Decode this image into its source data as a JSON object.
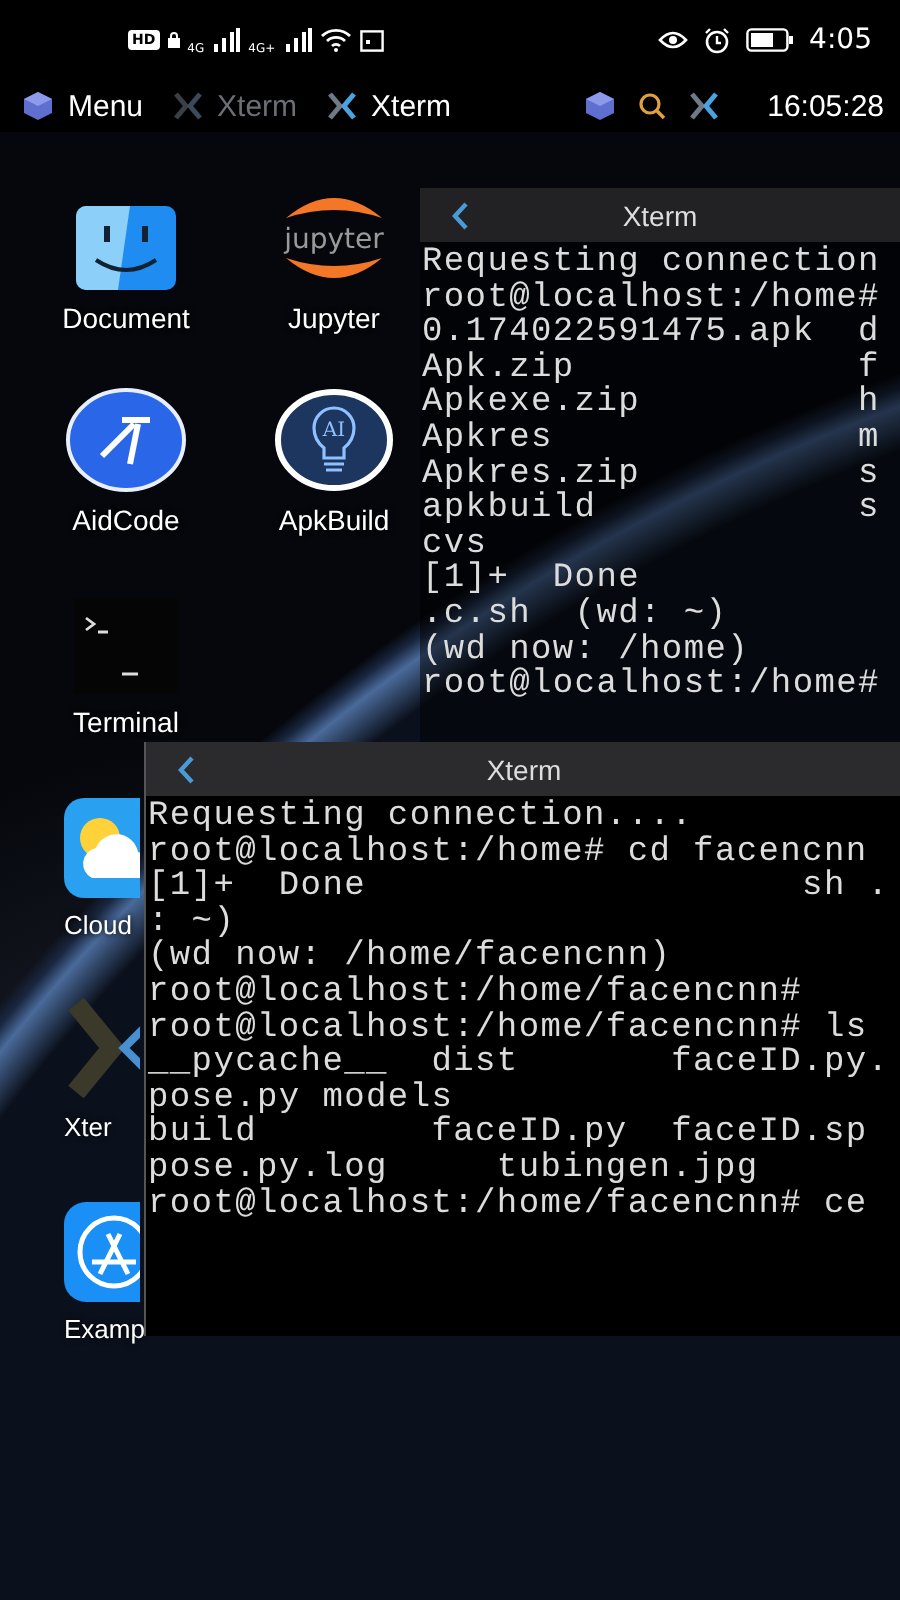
{
  "status_bar": {
    "badges": [
      "HD",
      "4G",
      "4G+"
    ],
    "time": "4:05"
  },
  "taskbar": {
    "items": [
      {
        "kind": "menu",
        "label": "Menu"
      },
      {
        "kind": "window",
        "label": "Xterm",
        "selected": false
      },
      {
        "kind": "window",
        "label": "Xterm",
        "selected": true
      }
    ],
    "clock": "16:05:28"
  },
  "desktop_icons": [
    {
      "kind": "finder",
      "label": "Document"
    },
    {
      "kind": "jupyter",
      "label": "Jupyter",
      "logo_text": "jupyter"
    },
    {
      "kind": "aidcode",
      "label": "AidCode"
    },
    {
      "kind": "bulb",
      "label": "ApkBuild",
      "logo_text": "AI"
    },
    {
      "kind": "terminal",
      "label": "Terminal"
    },
    {
      "kind": "weather",
      "label": "Cloud"
    },
    {
      "kind": "xterm",
      "label": "Xter"
    },
    {
      "kind": "appstore",
      "label": "Examp"
    }
  ],
  "windows": [
    {
      "title": "Xterm",
      "translucent": true,
      "lines": [
        "Requesting connection",
        "root@localhost:/home#",
        "0.174022591475.apk  d",
        "Apk.zip             f",
        "Apkexe.zip          h",
        "Apkres              m",
        "Apkres.zip          s",
        "apkbuild            s",
        "cvs",
        "[1]+  Done",
        ".c.sh  (wd: ~)",
        "(wd now: /home)",
        "root@localhost:/home#"
      ]
    },
    {
      "title": "Xterm",
      "translucent": false,
      "lines": [
        "Requesting connection....",
        "root@localhost:/home# cd facencnn",
        "[1]+  Done                    sh .",
        ": ~)",
        "(wd now: /home/facencnn)",
        "root@localhost:/home/facencnn#",
        "root@localhost:/home/facencnn# ls",
        "__pycache__  dist       faceID.py.",
        "pose.py models",
        "build        faceID.py  faceID.sp",
        "pose.py.log     tubingen.jpg",
        "root@localhost:/home/facencnn# ce"
      ]
    }
  ]
}
